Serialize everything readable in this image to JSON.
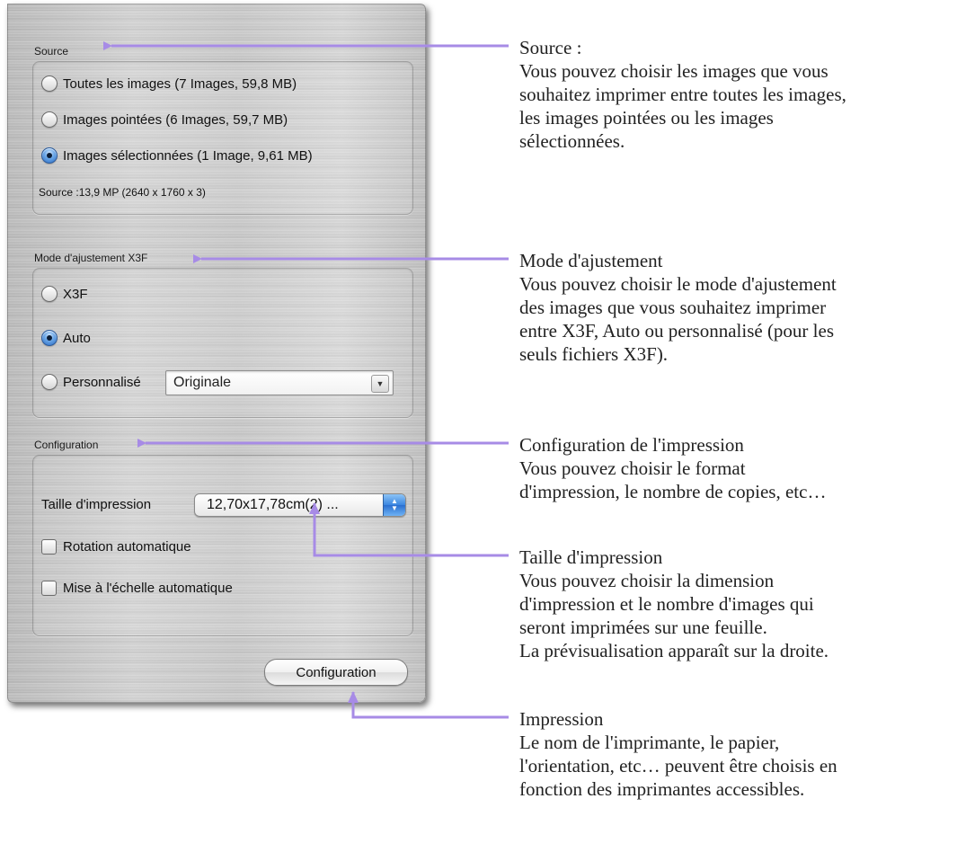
{
  "source": {
    "title": "Source",
    "options": [
      {
        "label": "Toutes les images  (7 Images, 59,8 MB)",
        "selected": false
      },
      {
        "label": "Images pointées  (6 Images, 59,7 MB)",
        "selected": false
      },
      {
        "label": "Images sélectionnées  (1 Image, 9,61 MB)",
        "selected": true
      }
    ],
    "info": "Source :13,9 MP (2640 x 1760 x 3)"
  },
  "mode": {
    "title": "Mode d'ajustement X3F",
    "options": [
      {
        "label": "X3F",
        "selected": false
      },
      {
        "label": "Auto",
        "selected": true
      },
      {
        "label": "Personnalisé",
        "selected": false
      }
    ],
    "custom_select_value": "Originale"
  },
  "configuration": {
    "title": "Configuration",
    "print_size_label": "Taille d'impression",
    "print_size_value": "12,70x17,78cm(2) ...",
    "auto_rotate_label": "Rotation automatique",
    "auto_rotate_checked": false,
    "auto_scale_label": "Mise à l'échelle automatique",
    "auto_scale_checked": false,
    "button_label": "Configuration"
  },
  "annotations": {
    "source": {
      "heading": "Source :",
      "lines": [
        "Vous pouvez choisir les images que vous",
        "souhaitez imprimer entre toutes les images,",
        "les images pointées ou les images",
        "sélectionnées."
      ]
    },
    "mode": {
      "heading": "Mode d'ajustement",
      "lines": [
        "Vous pouvez choisir le mode d'ajustement",
        "des images que vous souhaitez imprimer",
        "entre X3F, Auto ou personnalisé (pour les",
        "seuls fichiers X3F)."
      ]
    },
    "config": {
      "heading": "Configuration de l'impression",
      "lines": [
        "Vous pouvez choisir le format",
        "d'impression, le nombre de copies, etc…"
      ]
    },
    "size": {
      "heading": "Taille d'impression",
      "lines": [
        "Vous pouvez choisir la dimension",
        "d'impression et le nombre d'images qui",
        "seront imprimées sur une feuille.",
        "La prévisualisation apparaît sur la droite."
      ]
    },
    "print": {
      "heading": "Impression",
      "lines": [
        "Le nom de l'imprimante, le papier,",
        "l'orientation, etc… peuvent être choisis en",
        "fonction des imprimantes accessibles."
      ]
    }
  },
  "colors": {
    "annotation_line": "#a78be6",
    "radio_selected": "#2a6cc4",
    "stepper": "#3a86e0"
  }
}
